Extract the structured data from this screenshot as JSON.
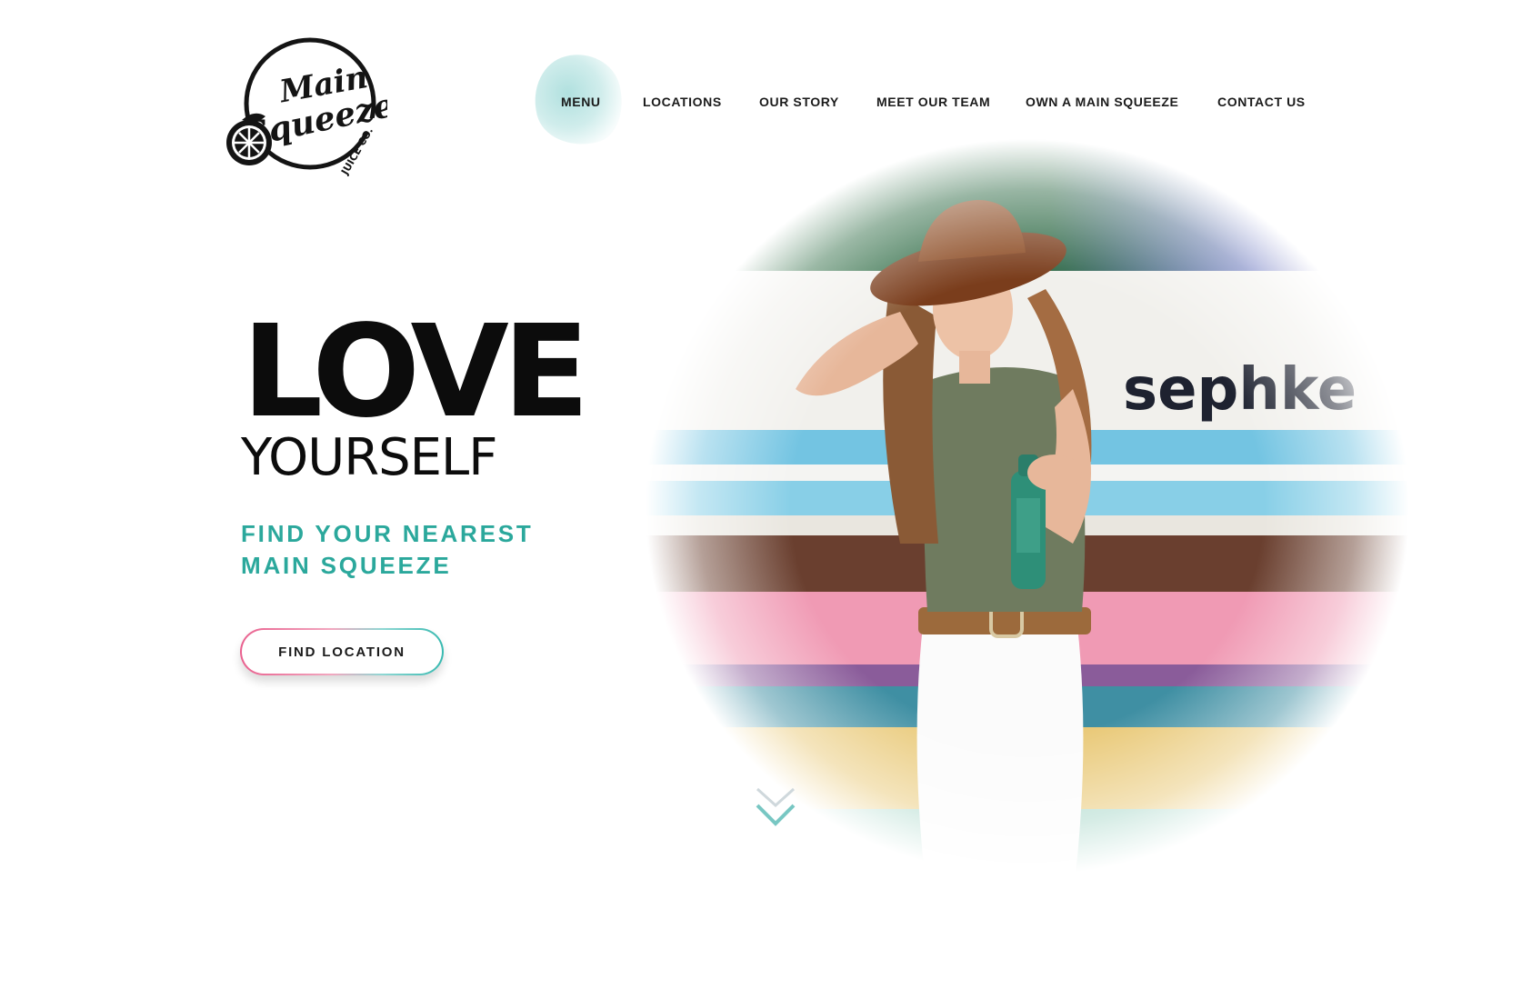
{
  "brand": {
    "logo_text_main": "Main",
    "logo_text_squeeze": "Squeeze",
    "logo_text_juice": "JUICE CO."
  },
  "nav": {
    "items": [
      {
        "label": "MENU"
      },
      {
        "label": "LOCATIONS"
      },
      {
        "label": "OUR STORY"
      },
      {
        "label": "MEET OUR TEAM"
      },
      {
        "label": "OWN A MAIN SQUEEZE"
      },
      {
        "label": "CONTACT US"
      }
    ]
  },
  "hero": {
    "headline_line1": "LOVE",
    "headline_line2": "YOURSELF",
    "subheadline_line1": "FIND YOUR NEAREST",
    "subheadline_line2": "MAIN SQUEEZE",
    "cta_label": "FIND LOCATION",
    "wall_text": "sephke"
  },
  "scroll": {
    "icon": "chevron-down-icon"
  },
  "colors": {
    "accent_teal": "#2ba89c",
    "accent_pink": "#e9608e",
    "text_dark": "#0c0c0c"
  }
}
